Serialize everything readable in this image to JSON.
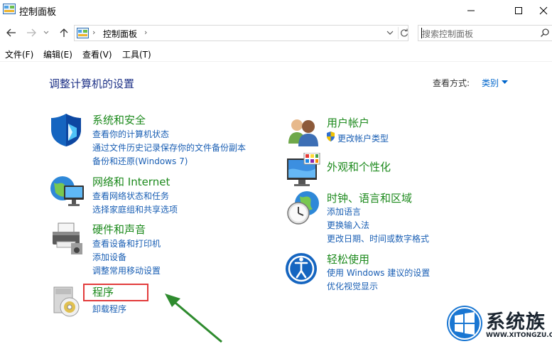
{
  "window": {
    "title": "控制面板"
  },
  "address": {
    "crumb": "控制面板",
    "search_placeholder": "搜索控制面板"
  },
  "menu": [
    "文件(F)",
    "编辑(E)",
    "查看(V)",
    "工具(T)"
  ],
  "main": {
    "title": "调整计算机的设置",
    "view_by_label": "查看方式:",
    "view_by_value": "类别"
  },
  "categories": {
    "system": {
      "title": "系统和安全",
      "icon": "shield-icon",
      "links": [
        "查看你的计算机状态",
        "通过文件历史记录保存你的文件备份副本",
        "备份和还原(Windows 7)"
      ]
    },
    "network": {
      "title": "网络和 Internet",
      "icon": "network-globe-icon",
      "links": [
        "查看网络状态和任务",
        "选择家庭组和共享选项"
      ]
    },
    "hardware": {
      "title": "硬件和声音",
      "icon": "printer-icon",
      "links": [
        "查看设备和打印机",
        "添加设备",
        "调整常用移动设置"
      ]
    },
    "programs": {
      "title": "程序",
      "icon": "programs-disc-icon",
      "links": [
        "卸载程序"
      ]
    },
    "users": {
      "title": "用户帐户",
      "icon": "users-icon",
      "links": [
        "更改帐户类型"
      ]
    },
    "appearance": {
      "title": "外观和个性化",
      "icon": "monitor-palette-icon",
      "links": []
    },
    "clock": {
      "title": "时钟、语言和区域",
      "icon": "clock-globe-icon",
      "links": [
        "添加语言",
        "更换输入法",
        "更改日期、时间或数字格式"
      ]
    },
    "ease": {
      "title": "轻松使用",
      "icon": "ease-of-access-icon",
      "links": [
        "使用 Windows 建议的设置",
        "优化视觉显示"
      ]
    }
  },
  "watermark": {
    "text": "系统族",
    "url": "WWW.XITONGZU.COM"
  },
  "colors": {
    "category_title": "#1d8a1d",
    "link": "#1a5fb4",
    "page_title": "#1e3287",
    "highlight": "#e23b3b",
    "arrow": "#2e8b2e"
  }
}
